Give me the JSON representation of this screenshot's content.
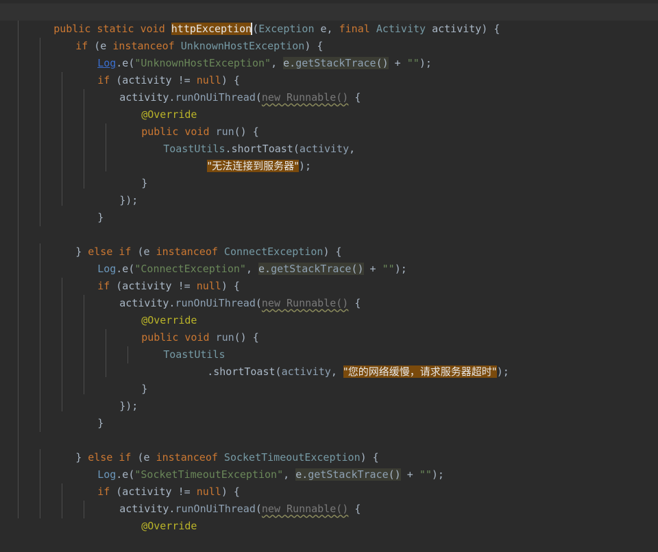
{
  "editor": {
    "language": "java",
    "theme_colors": {
      "background": "#2b2b2b",
      "keyword": "#cc7832",
      "identifier": "#a9b7c6",
      "string": "#6a8759",
      "annotation": "#bbb529",
      "highlight": "#7a4a0c"
    }
  },
  "code": {
    "l01": {
      "a": "public static void ",
      "b": "httpException",
      "c": "(",
      "d": "Exception",
      "e": " e, ",
      "f": "final ",
      "g": "Activity",
      "h": " activity) {"
    },
    "l02": {
      "a": "if",
      "b": " (e ",
      "c": "instanceof",
      "d": " UnknownHostException",
      "e": ") {"
    },
    "l03": {
      "a": "Log",
      "b": ".e(",
      "c": "\"UnknownHostException\"",
      "d": ", ",
      "e": "e.",
      "f": "getStackTrace",
      "g": "()",
      "h": " + ",
      "i": "\"\"",
      "j": ");"
    },
    "l04": {
      "a": "if",
      "b": " (activity != ",
      "c": "null",
      "d": ") {"
    },
    "l05": {
      "a": "activity.",
      "b": "runOnUiThread",
      "c": "(",
      "d": "new Runnable()",
      "e": " {"
    },
    "l06": {
      "a": "@Override"
    },
    "l07": {
      "a": "public void ",
      "b": "run",
      "c": "() {"
    },
    "l08": {
      "a": "ToastUtils",
      "b": ".shortToast(",
      "c": "activity",
      "d": ","
    },
    "l09": {
      "a": "\"无法连接到服务器\"",
      "b": ");"
    },
    "l10": {
      "a": "}"
    },
    "l11": {
      "a": "});"
    },
    "l12": {
      "a": "}"
    },
    "l14": {
      "a": "} ",
      "b": "else if",
      "c": " (e ",
      "d": "instanceof",
      "e": " ConnectException",
      "f": ") {"
    },
    "l15": {
      "a": "Log",
      "b": ".e(",
      "c": "\"ConnectException\"",
      "d": ", ",
      "e": "e.",
      "f": "getStackTrace",
      "g": "()",
      "h": " + ",
      "i": "\"\"",
      "j": ");"
    },
    "l16": {
      "a": "if",
      "b": " (activity != ",
      "c": "null",
      "d": ") {"
    },
    "l17": {
      "a": "activity.",
      "b": "runOnUiThread",
      "c": "(",
      "d": "new Runnable()",
      "e": " {"
    },
    "l18": {
      "a": "@Override"
    },
    "l19": {
      "a": "public void ",
      "b": "run",
      "c": "() {"
    },
    "l20": {
      "a": "ToastUtils"
    },
    "l21": {
      "a": ".shortToast(",
      "b": "activity",
      "c": ", ",
      "d": "\"您的网络缓慢，请求服务器超时\"",
      "e": ");"
    },
    "l22": {
      "a": "}"
    },
    "l23": {
      "a": "});"
    },
    "l24": {
      "a": "}"
    },
    "l26": {
      "a": "} ",
      "b": "else if",
      "c": " (e ",
      "d": "instanceof",
      "e": " SocketTimeoutException",
      "f": ") {"
    },
    "l27": {
      "a": "Log",
      "b": ".e(",
      "c": "\"SocketTimeoutException\"",
      "d": ", ",
      "e": "e.",
      "f": "getStackTrace",
      "g": "()",
      "h": " + ",
      "i": "\"\"",
      "j": ");"
    },
    "l28": {
      "a": "if",
      "b": " (activity != ",
      "c": "null",
      "d": ") {"
    },
    "l29": {
      "a": "activity.",
      "b": "runOnUiThread",
      "c": "(",
      "d": "new Runnable()",
      "e": " {"
    },
    "l30": {
      "a": "@Override"
    }
  }
}
